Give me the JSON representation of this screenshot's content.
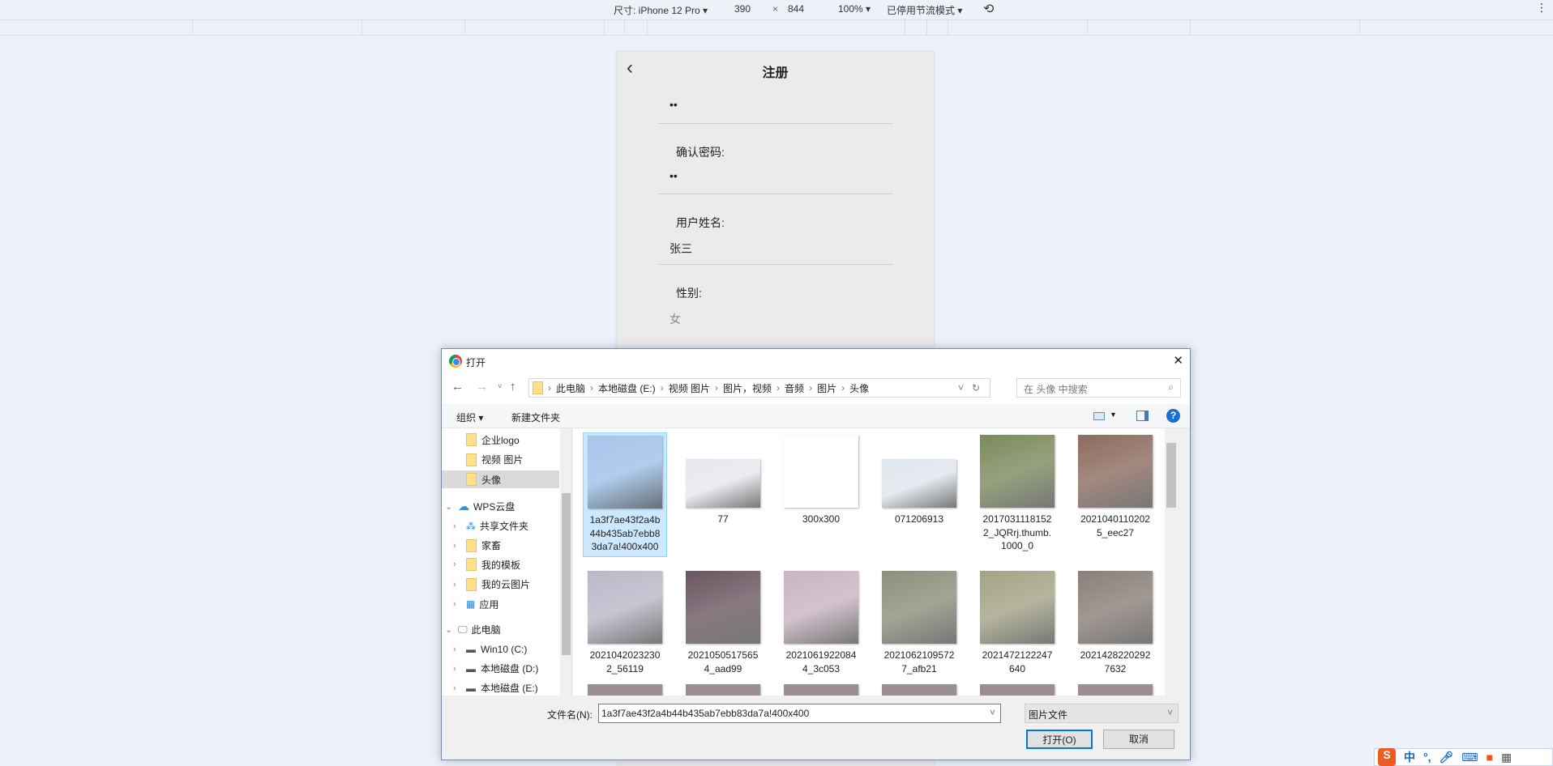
{
  "devtools": {
    "size_label": "尺寸: iPhone 12 Pro ▾",
    "width": "390",
    "times": "×",
    "height": "844",
    "zoom": "100% ▾",
    "throttle": "已停用节流模式 ▾"
  },
  "phone": {
    "title": "注册",
    "password_value": "••",
    "confirm_label": "确认密码:",
    "confirm_value": "••",
    "name_label": "用户姓名:",
    "name_value": "张三",
    "gender_label": "性别:",
    "gender_placeholder": "女"
  },
  "dialog": {
    "title": "打开",
    "close": "✕",
    "breadcrumb": [
      "此电脑",
      "本地磁盘 (E:)",
      "视频 图片",
      "图片，视频",
      "音频",
      "图片",
      "头像"
    ],
    "search_placeholder": "在 头像 中搜索",
    "organize": "组织 ▾",
    "new_folder": "新建文件夹",
    "nav": [
      {
        "label": "企业logo",
        "icon": "folder-icon"
      },
      {
        "label": "视频 图片",
        "icon": "folder-icon"
      },
      {
        "label": "头像",
        "icon": "folder-icon",
        "selected": true
      },
      {
        "label": "WPS云盘",
        "icon": "cloud-icon",
        "expanded": true
      },
      {
        "label": "共享文件夹",
        "icon": "share-icon"
      },
      {
        "label": "家畜",
        "icon": "folder-icon"
      },
      {
        "label": "我的模板",
        "icon": "folder-icon"
      },
      {
        "label": "我的云图片",
        "icon": "folder-icon"
      },
      {
        "label": "应用",
        "icon": "apps-icon"
      },
      {
        "label": "此电脑",
        "icon": "computer-icon",
        "expanded": true
      },
      {
        "label": "Win10 (C:)",
        "icon": "drive-icon"
      },
      {
        "label": "本地磁盘 (D:)",
        "icon": "drive-icon"
      },
      {
        "label": "本地磁盘 (E:)",
        "icon": "drive-icon"
      }
    ],
    "files": [
      {
        "name": "1a3f7ae43f2a4b44b435ab7ebb83da7a!400x400",
        "lines": [
          "1a3f7ae43f2a4",
          "b44b435ab7eb",
          "b83da7a!400x4",
          "00"
        ],
        "selected": true,
        "color": "#a9c6ea"
      },
      {
        "name": "77",
        "lines": [
          "77"
        ],
        "color": "#e6e8ee",
        "wide": true
      },
      {
        "name": "300x300",
        "lines": [
          "300x300"
        ],
        "color": "#555"
      },
      {
        "name": "071206913",
        "lines": [
          "071206913"
        ],
        "color": "#dfe6ec",
        "wide": true
      },
      {
        "name": "20170311181522_JQRrj.thumb.1000_0",
        "lines": [
          "2017031118152",
          "2_JQRrj.thumb.",
          "1000_0"
        ],
        "color": "#7b8a5c"
      },
      {
        "name": "20210401102025_eec27",
        "lines": [
          "2021040110202",
          "5_eec27"
        ],
        "color": "#8c6b5e"
      },
      {
        "name": "20210420232302_56119",
        "lines": [
          "2021042023230",
          "2_56119"
        ],
        "color": "#b9b8c8"
      },
      {
        "name": "20210505175654_aad99",
        "lines": [
          "2021050517565",
          "4_aad99"
        ],
        "color": "#6a5660"
      },
      {
        "name": "20210619220844_3c053",
        "lines": [
          "2021061922084",
          "4_3c053"
        ],
        "color": "#c9b4c2"
      },
      {
        "name": "20210621095727_afb21",
        "lines": [
          "2021062109572",
          "7_afb21"
        ],
        "color": "#8a907a"
      },
      {
        "name": "2021472122247640",
        "lines": [
          "2021472122247",
          "640"
        ],
        "color": "#a3a386"
      },
      {
        "name": "20214282202927632",
        "lines": [
          "2021428220292",
          "7632"
        ],
        "color": "#8a7f78"
      }
    ],
    "filename_label": "文件名(N):",
    "filename_value": "1a3f7ae43f2a4b44b435ab7ebb83da7a!400x400",
    "filetype": "图片文件",
    "open_button": "打开(O)",
    "cancel_button": "取消"
  },
  "ime": {
    "mode": "中",
    "punct": "°,"
  }
}
